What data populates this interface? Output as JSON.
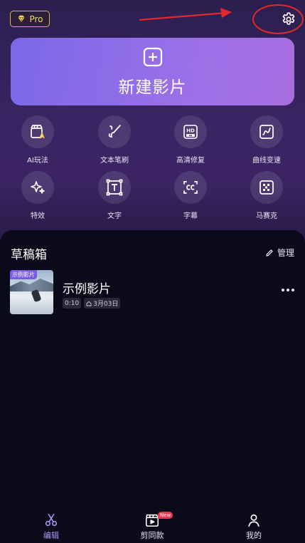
{
  "header": {
    "pro_label": "Pro",
    "settings_icon": "gear-icon"
  },
  "new_film": {
    "label": "新建影片",
    "icon": "plus-square-icon"
  },
  "tools": [
    {
      "label": "AI玩法",
      "icon": "ai-clapper-icon"
    },
    {
      "label": "文本笔刷",
      "icon": "brush-icon"
    },
    {
      "label": "高清修复",
      "icon": "hd-4k-icon"
    },
    {
      "label": "曲线变速",
      "icon": "curve-speed-icon"
    },
    {
      "label": "特效",
      "icon": "sparkle-icon"
    },
    {
      "label": "文字",
      "icon": "text-icon"
    },
    {
      "label": "字幕",
      "icon": "caption-cc-icon"
    },
    {
      "label": "马赛克",
      "icon": "mosaic-icon"
    }
  ],
  "drafts": {
    "title": "草稿箱",
    "manage_label": "管理",
    "items": [
      {
        "tag": "示例影片",
        "name": "示例影片",
        "duration": "0:10",
        "date": "3月03日"
      }
    ]
  },
  "tabbar": {
    "items": [
      {
        "label": "编辑",
        "icon": "scissors-icon",
        "active": true
      },
      {
        "label": "剪同款",
        "icon": "template-clapper-icon",
        "badge": "New"
      },
      {
        "label": "我的",
        "icon": "person-icon"
      }
    ]
  },
  "colors": {
    "accent": "#a79cf5",
    "button_gradient_start": "#7b68e8",
    "button_gradient_end": "#a86ee0",
    "pro_gold": "#d9b93a",
    "annotation_red": "#e02a2a",
    "new_badge": "#f2364c"
  }
}
